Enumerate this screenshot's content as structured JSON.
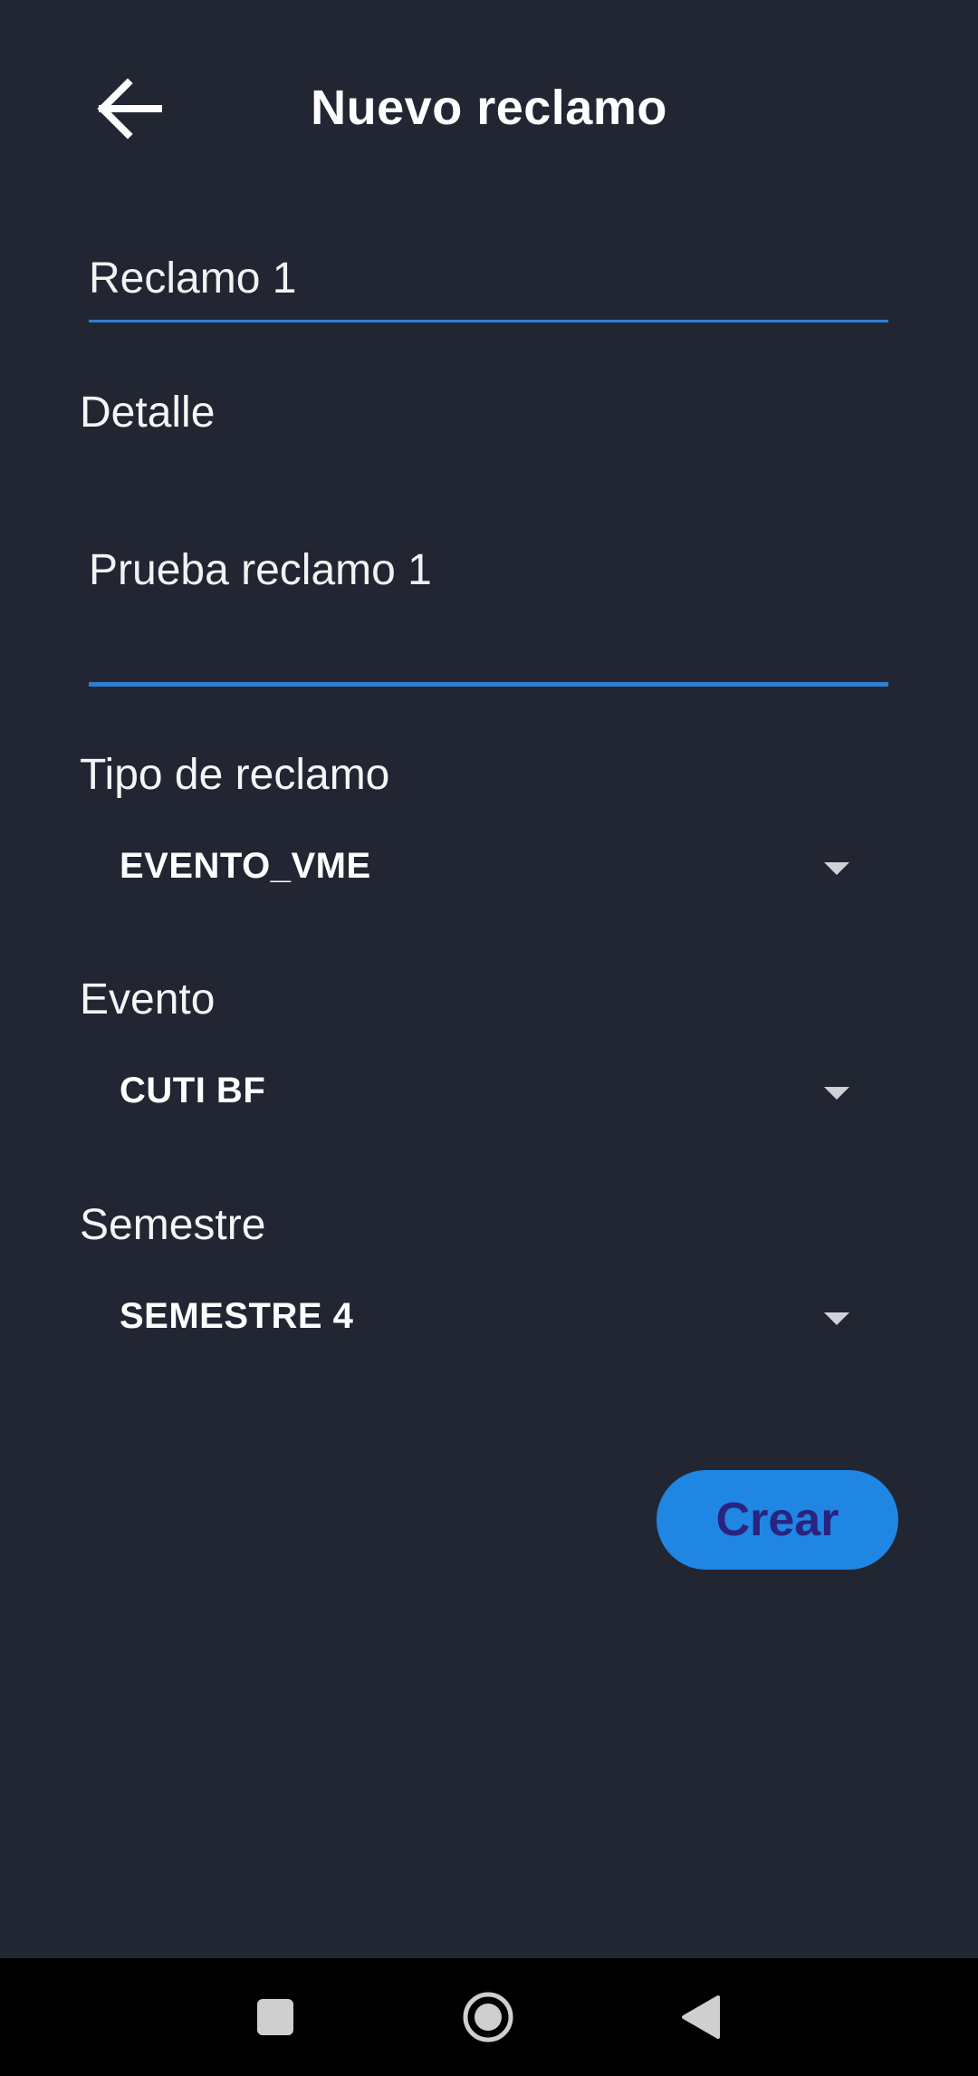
{
  "header": {
    "title": "Nuevo reclamo",
    "back_icon": "arrow-left-icon"
  },
  "form": {
    "title_value": "Reclamo 1",
    "detail_label": "Detalle",
    "detail_value": "Prueba reclamo 1",
    "tipo_label": "Tipo de reclamo",
    "tipo_value": "EVENTO_VME",
    "evento_label": "Evento",
    "evento_value": "CUTI BF",
    "semestre_label": "Semestre",
    "semestre_value": "SEMESTRE 4",
    "create_label": "Crear"
  },
  "navbar": {
    "recents_icon": "square-icon",
    "home_icon": "circle-home-icon",
    "back_icon": "triangle-back-icon"
  },
  "colors": {
    "background": "#212632",
    "accent": "#1f86e4",
    "underline": "#2e7fd6",
    "button_text": "#2a237f",
    "navbar": "#000000"
  }
}
